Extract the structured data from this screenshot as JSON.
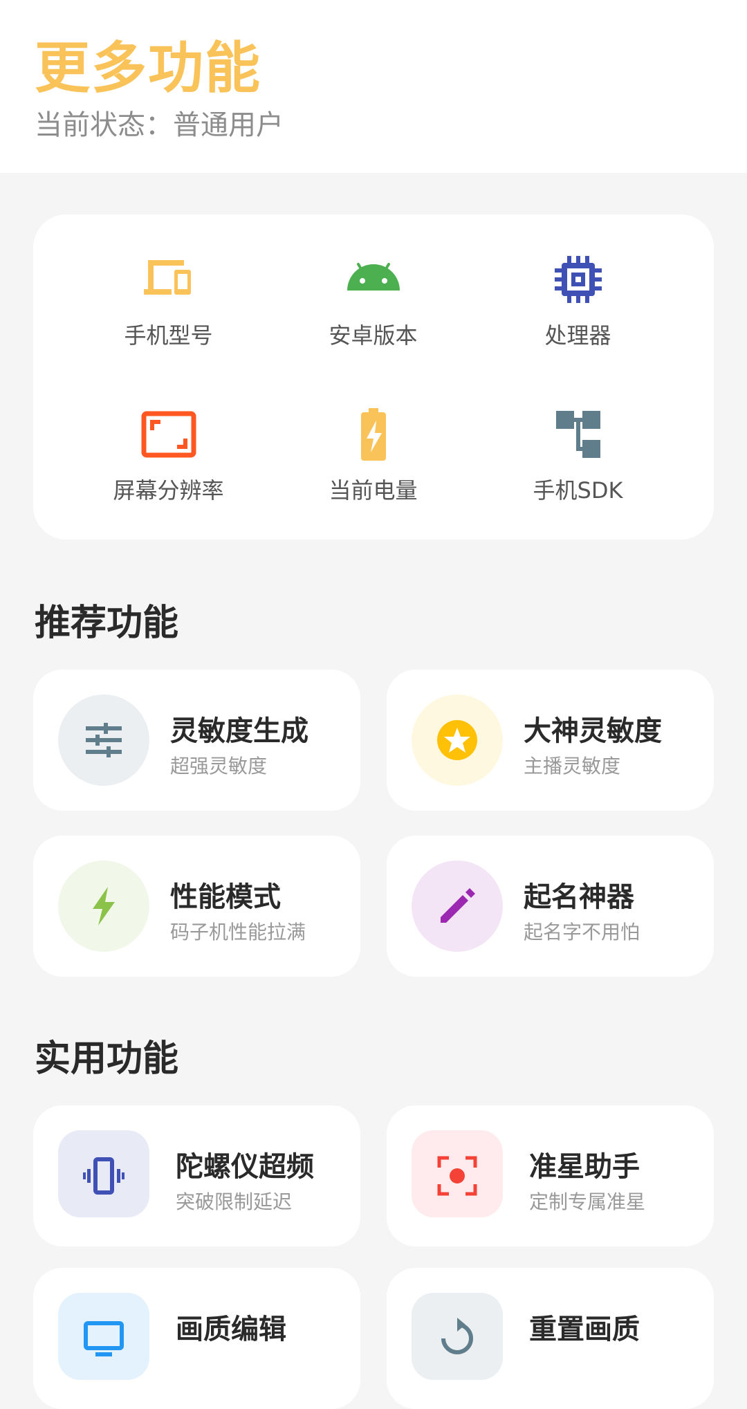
{
  "header": {
    "title": "更多功能",
    "status": "当前状态：普通用户"
  },
  "device_info": {
    "items": [
      {
        "label": "手机型号",
        "icon": "devices-icon",
        "color": "#f9c35a"
      },
      {
        "label": "安卓版本",
        "icon": "android-icon",
        "color": "#4caf50"
      },
      {
        "label": "处理器",
        "icon": "cpu-icon",
        "color": "#3f51b5"
      },
      {
        "label": "屏幕分辨率",
        "icon": "screen-frame-icon",
        "color": "#ff5722"
      },
      {
        "label": "当前电量",
        "icon": "battery-charging-icon",
        "color": "#f9c35a"
      },
      {
        "label": "手机SDK",
        "icon": "sdk-tree-icon",
        "color": "#607d8b"
      }
    ]
  },
  "recommended": {
    "title": "推荐功能",
    "items": [
      {
        "title": "灵敏度生成",
        "subtitle": "超强灵敏度",
        "icon": "sliders-icon",
        "bg": "#eceff1",
        "color": "#607d8b"
      },
      {
        "title": "大神灵敏度",
        "subtitle": "主播灵敏度",
        "icon": "star-badge-icon",
        "bg": "#fff8e1",
        "color": "#ffc107"
      },
      {
        "title": "性能模式",
        "subtitle": "码子机性能拉满",
        "icon": "bolt-icon",
        "bg": "#f1f8e9",
        "color": "#8bc34a"
      },
      {
        "title": "起名神器",
        "subtitle": "起名字不用怕",
        "icon": "pencil-icon",
        "bg": "#f3e5f5",
        "color": "#9c27b0"
      }
    ]
  },
  "practical": {
    "title": "实用功能",
    "items": [
      {
        "title": "陀螺仪超频",
        "subtitle": "突破限制延迟",
        "icon": "vibrate-icon",
        "bg": "#e8eaf6",
        "color": "#3f51b5"
      },
      {
        "title": "准星助手",
        "subtitle": "定制专属准星",
        "icon": "crosshair-icon",
        "bg": "#ffebee",
        "color": "#f44336"
      },
      {
        "title": "画质编辑",
        "subtitle": "",
        "icon": "monitor-icon",
        "bg": "#e3f2fd",
        "color": "#2196f3"
      },
      {
        "title": "重置画质",
        "subtitle": "",
        "icon": "reset-icon",
        "bg": "#eceff1",
        "color": "#607d8b"
      }
    ]
  }
}
